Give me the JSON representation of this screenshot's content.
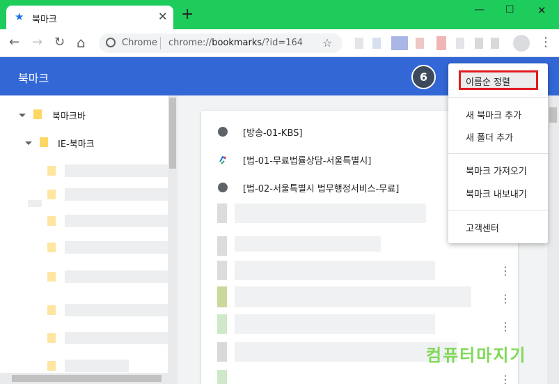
{
  "window": {
    "tab_title": "북마크",
    "tab_star_icon": "★",
    "tab_close_icon": "✕",
    "new_tab_icon": "+",
    "minimize_icon": "—",
    "maximize_icon": "☐",
    "close_icon": "✕"
  },
  "toolbar": {
    "back_icon": "←",
    "forward_icon": "→",
    "reload_icon": "↻",
    "home_icon": "⌂",
    "omnibox_origin": "Chrome",
    "omnibox_url_scheme": "chrome://",
    "omnibox_url_host": "bookmarks",
    "omnibox_url_rest": "/?id=164",
    "bookmark_star_icon": "☆",
    "menu_icon": "⋮"
  },
  "header": {
    "title": "북마크",
    "step_number": "6",
    "menu_icon": "⋮"
  },
  "sidebar": {
    "items": [
      {
        "label": "북마크바",
        "expanded": true
      },
      {
        "label": "IE-북마크",
        "expanded": true
      }
    ]
  },
  "list": {
    "items": [
      {
        "label": "[방송-01-KBS]",
        "icon": "globe-icon"
      },
      {
        "label": "[법-01-무료법률상담-서울특별시]",
        "icon": "seoul-logo-icon"
      },
      {
        "label": "[법-02-서울특별시 법무행정서비스-무료]",
        "icon": "globe-icon"
      }
    ],
    "more_icon": "⋮"
  },
  "menu": {
    "items": [
      {
        "label": "이름순 정렬",
        "highlighted": true
      },
      {
        "label": "새 북마크 추가"
      },
      {
        "label": "새 폴더 추가"
      },
      {
        "label": "북마크 가져오기"
      },
      {
        "label": "북마크 내보내기"
      },
      {
        "label": "고객센터"
      }
    ],
    "highlight_color": "#e11b22"
  },
  "watermark": {
    "text": "컴퓨터마지기"
  },
  "colors": {
    "titlebar": "#1dcc5a",
    "header": "#3367d6",
    "folder": "#fdd663"
  }
}
